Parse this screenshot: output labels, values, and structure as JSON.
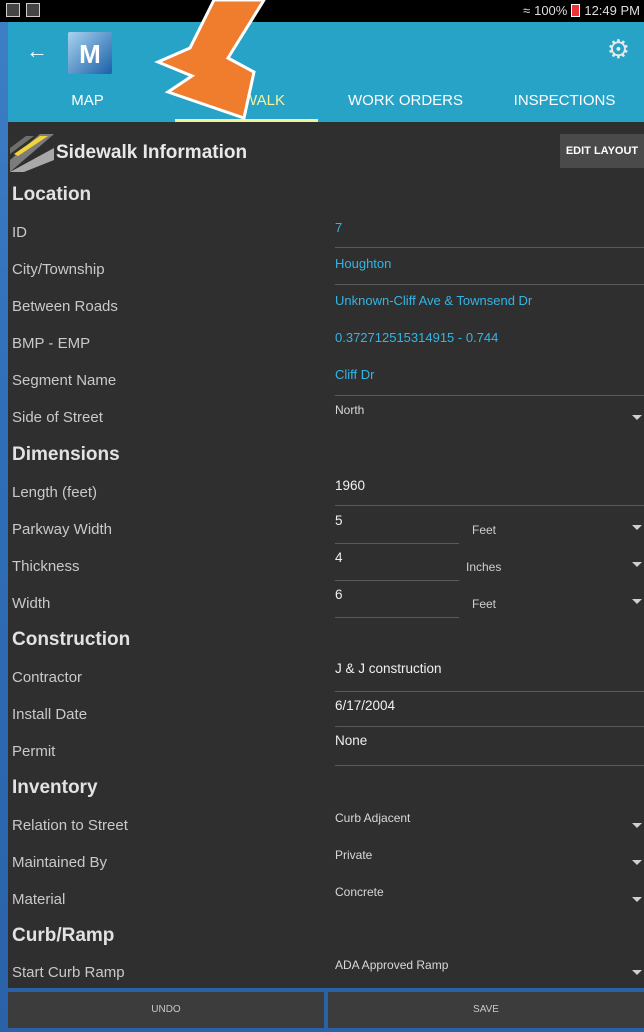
{
  "statusbar": {
    "battery": "100%",
    "time": "12:49 PM"
  },
  "appbar": {
    "logo_letter": "M"
  },
  "tabs": [
    {
      "label": "MAP"
    },
    {
      "label": "SIDEWALK"
    },
    {
      "label": "WORK ORDERS"
    },
    {
      "label": "INSPECTIONS"
    }
  ],
  "header": {
    "title": "Sidewalk Information",
    "edit_label": "EDIT LAYOUT"
  },
  "sections": {
    "location": "Location",
    "dimensions": "Dimensions",
    "construction": "Construction",
    "inventory": "Inventory",
    "curb": "Curb/Ramp"
  },
  "fields": {
    "id": {
      "label": "ID",
      "value": "7"
    },
    "city": {
      "label": "City/Township",
      "value": "Houghton"
    },
    "between": {
      "label": "Between Roads",
      "value": "Unknown-Cliff Ave & Townsend Dr"
    },
    "bmp": {
      "label": "BMP - EMP",
      "value": "0.372712515314915 - 0.744"
    },
    "segment": {
      "label": "Segment Name",
      "value": "Cliff Dr"
    },
    "side": {
      "label": "Side of Street",
      "value": "North"
    },
    "length": {
      "label": "Length (feet)",
      "value": "1960"
    },
    "parkway": {
      "label": "Parkway Width",
      "value": "5",
      "unit": "Feet"
    },
    "thickness": {
      "label": "Thickness",
      "value": "4",
      "unit": "Inches"
    },
    "width": {
      "label": "Width",
      "value": "6",
      "unit": "Feet"
    },
    "contractor": {
      "label": "Contractor",
      "value": "J & J construction"
    },
    "install": {
      "label": "Install Date",
      "value": "6/17/2004"
    },
    "permit": {
      "label": "Permit",
      "value": "None"
    },
    "relation": {
      "label": "Relation to Street",
      "value": "Curb Adjacent"
    },
    "maintained": {
      "label": "Maintained By",
      "value": "Private"
    },
    "material": {
      "label": "Material",
      "value": "Concrete"
    },
    "startcurb": {
      "label": "Start Curb Ramp",
      "value": "ADA Approved Ramp"
    }
  },
  "footer": {
    "undo": "UNDO",
    "save": "SAVE"
  }
}
